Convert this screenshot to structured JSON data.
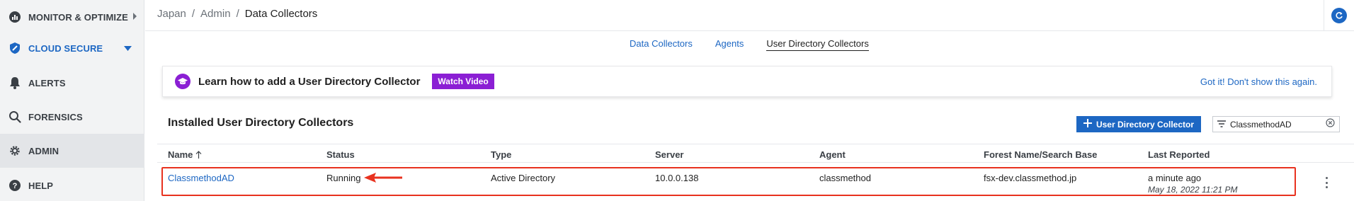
{
  "sidebar": {
    "items": [
      {
        "label": "MONITOR & OPTIMIZE",
        "icon": "chart-icon"
      },
      {
        "label": "CLOUD SECURE",
        "icon": "shield-icon"
      },
      {
        "label": "ALERTS",
        "icon": "bell-icon"
      },
      {
        "label": "FORENSICS",
        "icon": "search-icon"
      },
      {
        "label": "ADMIN",
        "icon": "gear-icon"
      },
      {
        "label": "HELP",
        "icon": "help-icon"
      }
    ]
  },
  "breadcrumb": {
    "items": [
      "Japan",
      "Admin"
    ],
    "separator": "/",
    "current": "Data Collectors"
  },
  "tabs": [
    {
      "label": "Data Collectors"
    },
    {
      "label": "Agents"
    },
    {
      "label": "User Directory Collectors",
      "active": true
    }
  ],
  "banner": {
    "text": "Learn how to add a User Directory Collector",
    "video_button": "Watch Video",
    "dismiss": "Got it! Don't show this again."
  },
  "section": {
    "title": "Installed User Directory Collectors",
    "add_button": "User Directory Collector",
    "filter_value": "ClassmethodAD"
  },
  "table": {
    "columns": [
      "Name",
      "Status",
      "Type",
      "Server",
      "Agent",
      "Forest Name/Search Base",
      "Last Reported"
    ],
    "rows": [
      {
        "name": "ClassmethodAD",
        "status": "Running",
        "type": "Active Directory",
        "server": "10.0.0.138",
        "agent": "classmethod",
        "forest": "fsx-dev.classmethod.jp",
        "last_reported": "a minute ago",
        "last_reported_time": "May 18, 2022 11:21 PM"
      }
    ]
  },
  "colors": {
    "accent": "#1d67c3",
    "banner_purple": "#8b1fd4",
    "highlight_red": "#e8321f"
  }
}
